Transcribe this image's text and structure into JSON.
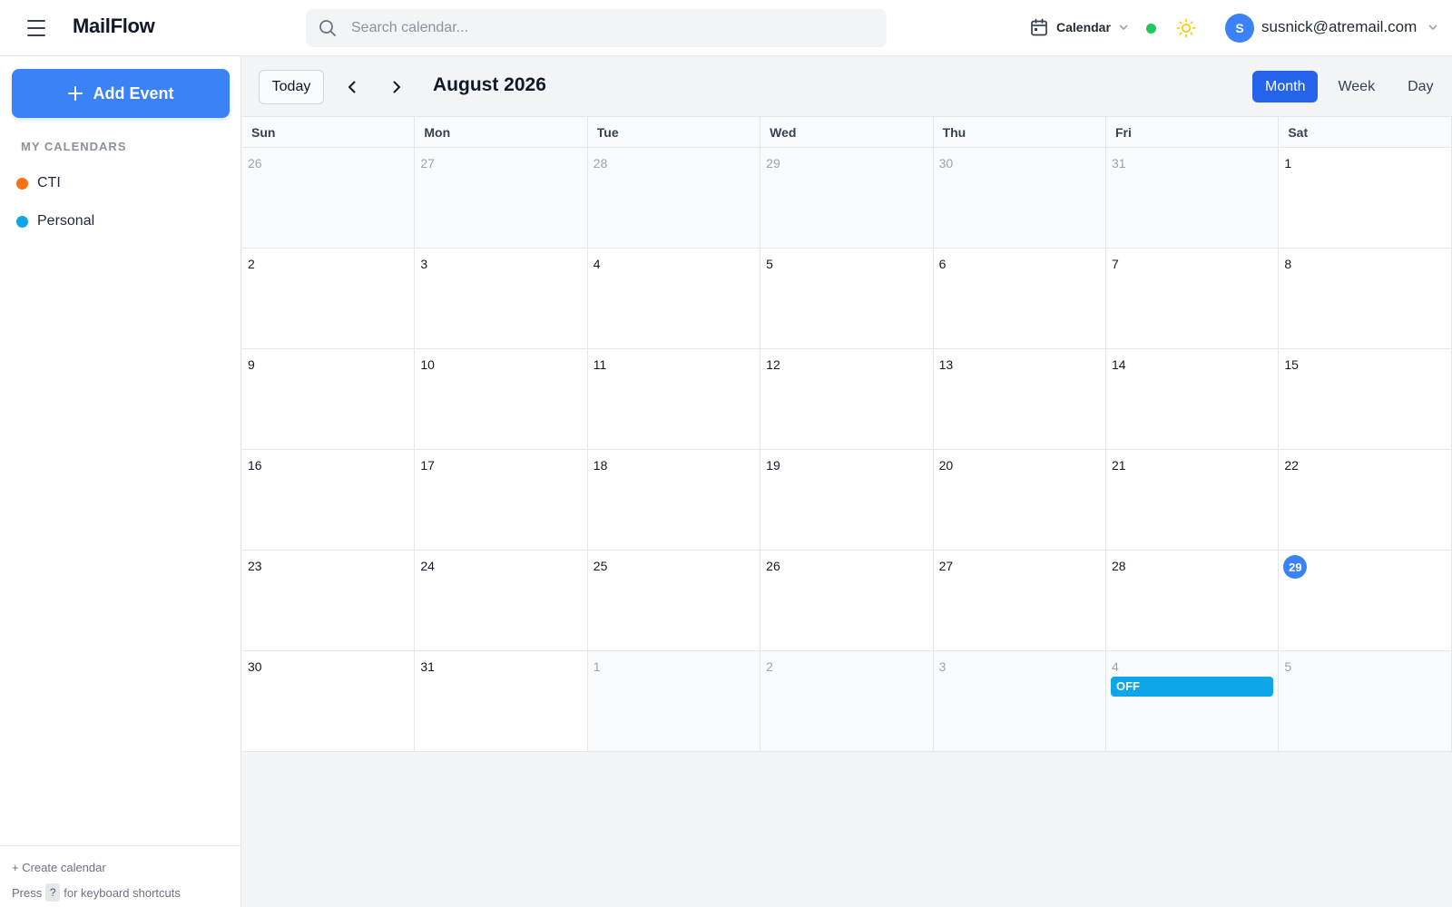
{
  "app": {
    "name": "MailFlow"
  },
  "search": {
    "placeholder": "Search calendar..."
  },
  "header": {
    "app_switch_label": "Calendar",
    "status_color": "#22c55e",
    "avatar_initial": "S",
    "email": "susnick@atremail.com"
  },
  "sidebar": {
    "add_event_label": "Add Event",
    "section_title": "MY CALENDARS",
    "calendars": [
      {
        "name": "CTI",
        "color": "#f97316"
      },
      {
        "name": "Personal",
        "color": "#0ea5e9"
      }
    ],
    "create_calendar": "+ Create calendar",
    "shortcut_prefix": "Press",
    "shortcut_key": "?",
    "shortcut_suffix": "for keyboard shortcuts"
  },
  "toolbar": {
    "today_label": "Today",
    "month_title": "August 2026",
    "views": [
      {
        "label": "Month",
        "active": true
      },
      {
        "label": "Week",
        "active": false
      },
      {
        "label": "Day",
        "active": false
      }
    ]
  },
  "calendar": {
    "weekdays": [
      "Sun",
      "Mon",
      "Tue",
      "Wed",
      "Thu",
      "Fri",
      "Sat"
    ],
    "weeks": [
      [
        {
          "d": "26",
          "other": true
        },
        {
          "d": "27",
          "other": true
        },
        {
          "d": "28",
          "other": true
        },
        {
          "d": "29",
          "other": true
        },
        {
          "d": "30",
          "other": true
        },
        {
          "d": "31",
          "other": true
        },
        {
          "d": "1"
        }
      ],
      [
        {
          "d": "2"
        },
        {
          "d": "3"
        },
        {
          "d": "4"
        },
        {
          "d": "5"
        },
        {
          "d": "6"
        },
        {
          "d": "7"
        },
        {
          "d": "8"
        }
      ],
      [
        {
          "d": "9"
        },
        {
          "d": "10"
        },
        {
          "d": "11"
        },
        {
          "d": "12"
        },
        {
          "d": "13"
        },
        {
          "d": "14"
        },
        {
          "d": "15"
        }
      ],
      [
        {
          "d": "16"
        },
        {
          "d": "17"
        },
        {
          "d": "18"
        },
        {
          "d": "19"
        },
        {
          "d": "20"
        },
        {
          "d": "21"
        },
        {
          "d": "22"
        }
      ],
      [
        {
          "d": "23"
        },
        {
          "d": "24"
        },
        {
          "d": "25"
        },
        {
          "d": "26"
        },
        {
          "d": "27"
        },
        {
          "d": "28"
        },
        {
          "d": "29",
          "today": true
        }
      ],
      [
        {
          "d": "30"
        },
        {
          "d": "31"
        },
        {
          "d": "1",
          "other": true
        },
        {
          "d": "2",
          "other": true
        },
        {
          "d": "3",
          "other": true
        },
        {
          "d": "4",
          "other": true,
          "events": [
            {
              "title": "OFF",
              "color": "#0ea5e9"
            }
          ]
        },
        {
          "d": "5",
          "other": true
        }
      ]
    ]
  }
}
